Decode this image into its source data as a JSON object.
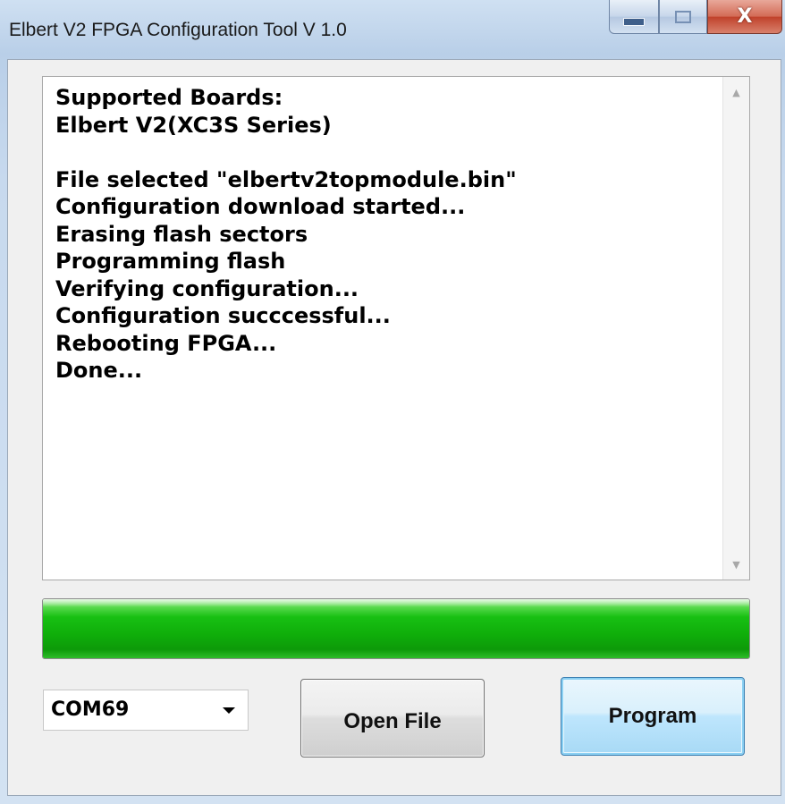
{
  "window": {
    "title": "Elbert V2 FPGA Configuration Tool V 1.0",
    "caption_buttons": {
      "minimize_icon": "minimize-icon",
      "maximize_icon": "maximize-icon",
      "close_icon": "close-icon",
      "close_glyph": "X"
    }
  },
  "log": {
    "lines": [
      "Supported Boards:",
      "Elbert V2(XC3S Series)",
      "",
      "File selected \"elbertv2topmodule.bin\"",
      "Configuration download started...",
      "Erasing flash sectors",
      "Programming flash",
      "Verifying configuration...",
      "Configuration succcessful...",
      "Rebooting FPGA...",
      "Done..."
    ],
    "scroll_up_glyph": "▲",
    "scroll_down_glyph": "▼"
  },
  "progress": {
    "percent": 100,
    "color": "#18c013"
  },
  "port_select": {
    "value": "COM69"
  },
  "buttons": {
    "open_file_label": "Open File",
    "program_label": "Program"
  },
  "colors": {
    "accent_blue": "#3c7fb1",
    "progress_green": "#18c013",
    "close_red": "#c0412a"
  }
}
